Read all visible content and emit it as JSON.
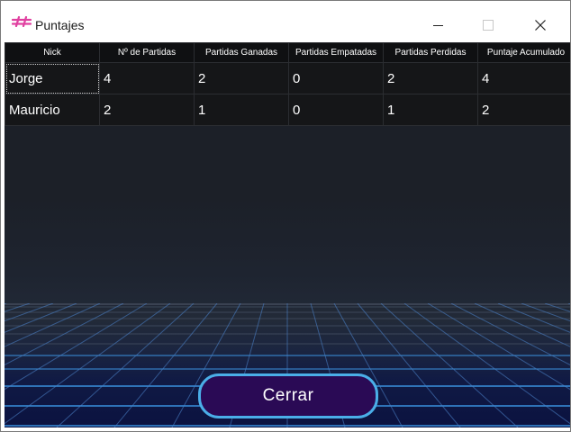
{
  "window": {
    "title": "Puntajes",
    "icon": "hash-icon",
    "controls": [
      "minimize-icon",
      "maximize-icon",
      "close-icon"
    ]
  },
  "table": {
    "headers": [
      "Nick",
      "Nº de Partidas",
      "Partidas Ganadas",
      "Partidas Empatadas",
      "Partidas Perdidas",
      "Puntaje Acumulado"
    ],
    "rows": [
      [
        "Jorge",
        "4",
        "2",
        "0",
        "2",
        "4"
      ],
      [
        "Mauricio",
        "2",
        "1",
        "0",
        "1",
        "2"
      ]
    ]
  },
  "buttons": {
    "close_label": "Cerrar"
  },
  "colors": {
    "icon": "#e040a0",
    "button_fill": "#2a0a55",
    "button_border": "#4aaee8"
  }
}
